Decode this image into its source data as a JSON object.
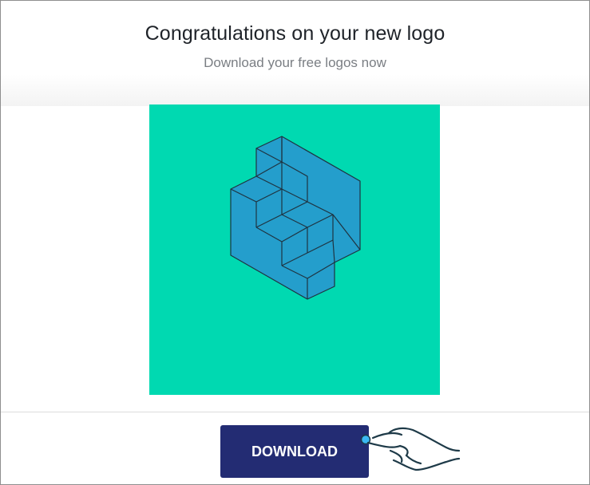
{
  "header": {
    "title": "Congratulations on your new logo",
    "subtitle": "Download your free logos now"
  },
  "logo": {
    "background_color": "#00d9b1",
    "shape_color": "#249ecc",
    "outline_color": "#1f3340",
    "icon": "isometric-stairs-hexagon-icon"
  },
  "actions": {
    "download_label": "DOWNLOAD",
    "download_color": "#232c73"
  },
  "cursor": {
    "icon": "pointing-hand-icon",
    "accent_color": "#3bb8f2",
    "stroke_color": "#1e3a48"
  }
}
